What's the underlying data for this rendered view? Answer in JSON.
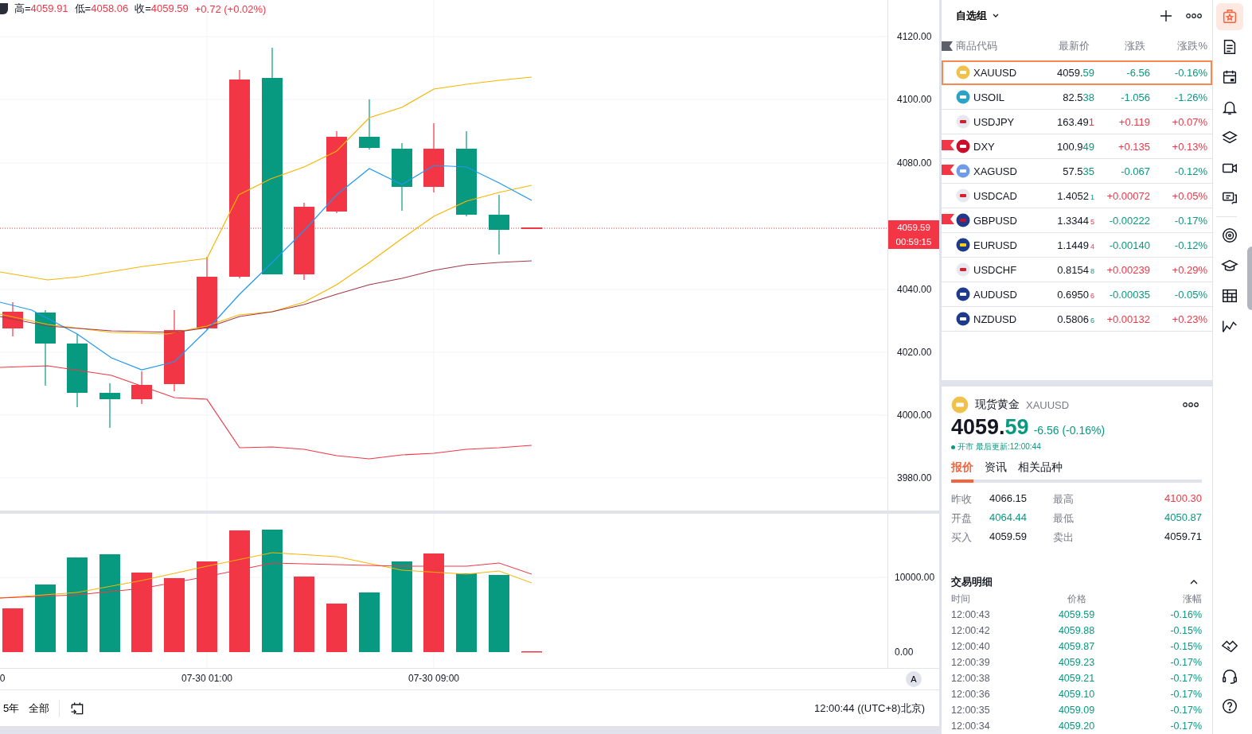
{
  "chart": {
    "ohlc": [
      {
        "label": "高=",
        "value": "4059.91"
      },
      {
        "label": "低=",
        "value": "4058.06"
      },
      {
        "label": "收=",
        "value": "4059.59"
      }
    ],
    "change": "+0.72 (+0.02%)",
    "price_ticks": [
      "4120.00",
      "4100.00",
      "4080.00",
      "4040.00",
      "4020.00",
      "4000.00",
      "3980.00"
    ],
    "last_price": "4059.59",
    "countdown": "00:59:15",
    "volume_ticks": [
      "10000.00",
      "0.00"
    ],
    "time_labels": [
      "0",
      "07-30 01:00",
      "07-30 09:00"
    ],
    "auto_scale": "A"
  },
  "bottom_bar": {
    "ranges": [
      "5年",
      "全部"
    ],
    "clock": "12:00:44 ((UTC+8)北京)"
  },
  "watchlist": {
    "title": "自选组",
    "columns": [
      "商品代码",
      "最新价",
      "涨跌",
      "涨跌%"
    ],
    "rows": [
      {
        "symbol": "XAUUSD",
        "price": "4059.",
        "price_tail": "59",
        "tail_up": false,
        "tail_small": false,
        "change": "-6.56",
        "change_pct": "-0.16%",
        "change_up": false,
        "flagged": false,
        "selected": true
      },
      {
        "symbol": "USOIL",
        "price": "82.5",
        "price_tail": "38",
        "tail_up": false,
        "tail_small": false,
        "change": "-1.056",
        "change_pct": "-1.26%",
        "change_up": false,
        "flagged": false,
        "selected": false
      },
      {
        "symbol": "USDJPY",
        "price": "163.49",
        "price_tail": "1",
        "tail_up": true,
        "tail_small": false,
        "change": "+0.119",
        "change_pct": "+0.07%",
        "change_up": true,
        "flagged": false,
        "selected": false
      },
      {
        "symbol": "DXY",
        "price": "100.9",
        "price_tail": "49",
        "tail_up": false,
        "tail_small": false,
        "change": "+0.135",
        "change_pct": "+0.13%",
        "change_up": true,
        "flagged": true,
        "selected": false
      },
      {
        "symbol": "XAGUSD",
        "price": "57.5",
        "price_tail": "35",
        "tail_up": false,
        "tail_small": false,
        "change": "-0.067",
        "change_pct": "-0.12%",
        "change_up": false,
        "flagged": true,
        "selected": false
      },
      {
        "symbol": "USDCAD",
        "price": "1.4052",
        "price_tail": "1",
        "tail_up": false,
        "tail_small": true,
        "change": "+0.00072",
        "change_pct": "+0.05%",
        "change_up": true,
        "flagged": false,
        "selected": false
      },
      {
        "symbol": "GBPUSD",
        "price": "1.3344",
        "price_tail": "5",
        "tail_up": true,
        "tail_small": true,
        "change": "-0.00222",
        "change_pct": "-0.17%",
        "change_up": false,
        "flagged": true,
        "selected": false
      },
      {
        "symbol": "EURUSD",
        "price": "1.1449",
        "price_tail": "4",
        "tail_up": true,
        "tail_small": true,
        "change": "-0.00140",
        "change_pct": "-0.12%",
        "change_up": false,
        "flagged": false,
        "selected": false
      },
      {
        "symbol": "USDCHF",
        "price": "0.8154",
        "price_tail": "8",
        "tail_up": false,
        "tail_small": true,
        "change": "+0.00239",
        "change_pct": "+0.29%",
        "change_up": true,
        "flagged": false,
        "selected": false
      },
      {
        "symbol": "AUDUSD",
        "price": "0.6950",
        "price_tail": "6",
        "tail_up": true,
        "tail_small": true,
        "change": "-0.00035",
        "change_pct": "-0.05%",
        "change_up": false,
        "flagged": false,
        "selected": false
      },
      {
        "symbol": "NZDUSD",
        "price": "0.5806",
        "price_tail": "6",
        "tail_up": false,
        "tail_small": true,
        "change": "+0.00132",
        "change_pct": "+0.23%",
        "change_up": true,
        "flagged": false,
        "selected": false
      }
    ]
  },
  "detail": {
    "name": "现货黄金",
    "symbol": "XAUUSD",
    "price": "4059.",
    "price_tail": "59",
    "change": "-6.56 (-0.16%)",
    "up": false,
    "market_status": "开市",
    "updated": "最后更新:12:00:44",
    "tabs": [
      {
        "label": "报价",
        "selected": true
      },
      {
        "label": "资讯",
        "selected": false
      },
      {
        "label": "相关品种",
        "selected": false
      }
    ],
    "stats": [
      {
        "label": "昨收",
        "value": "4066.15",
        "color": "#131722"
      },
      {
        "label": "最高",
        "value": "4100.30",
        "color": "#f23645"
      },
      {
        "label": "开盘",
        "value": "4064.44",
        "color": "#089981"
      },
      {
        "label": "最低",
        "value": "4050.87",
        "color": "#089981"
      },
      {
        "label": "买入",
        "value": "4059.59",
        "color": "#131722"
      },
      {
        "label": "卖出",
        "value": "4059.71",
        "color": "#131722"
      }
    ],
    "trades": {
      "title": "交易明细",
      "expanded": true,
      "columns": [
        "时间",
        "价格",
        "涨幅"
      ],
      "rows": [
        {
          "time": "12:00:43",
          "price": "4059.59",
          "change": "-0.16%"
        },
        {
          "time": "12:00:42",
          "price": "4059.88",
          "change": "-0.15%"
        },
        {
          "time": "12:00:40",
          "price": "4059.87",
          "change": "-0.15%"
        },
        {
          "time": "12:00:39",
          "price": "4059.23",
          "change": "-0.17%"
        },
        {
          "time": "12:00:38",
          "price": "4059.21",
          "change": "-0.17%"
        },
        {
          "time": "12:00:36",
          "price": "4059.10",
          "change": "-0.17%"
        },
        {
          "time": "12:00:35",
          "price": "4059.09",
          "change": "-0.17%"
        },
        {
          "time": "12:00:34",
          "price": "4059.20",
          "change": "-0.17%"
        }
      ]
    }
  },
  "sidebar": {
    "items": [
      {
        "selected": true
      },
      {
        "selected": false
      },
      {
        "selected": false
      },
      {
        "selected": false
      },
      {
        "selected": false
      },
      {
        "selected": false
      },
      {
        "selected": false
      },
      {
        "selected": false
      },
      {
        "selected": false
      },
      {
        "selected": false
      },
      {
        "selected": false
      },
      {
        "selected": false
      },
      {
        "selected": false
      },
      {
        "selected": false
      }
    ]
  }
}
